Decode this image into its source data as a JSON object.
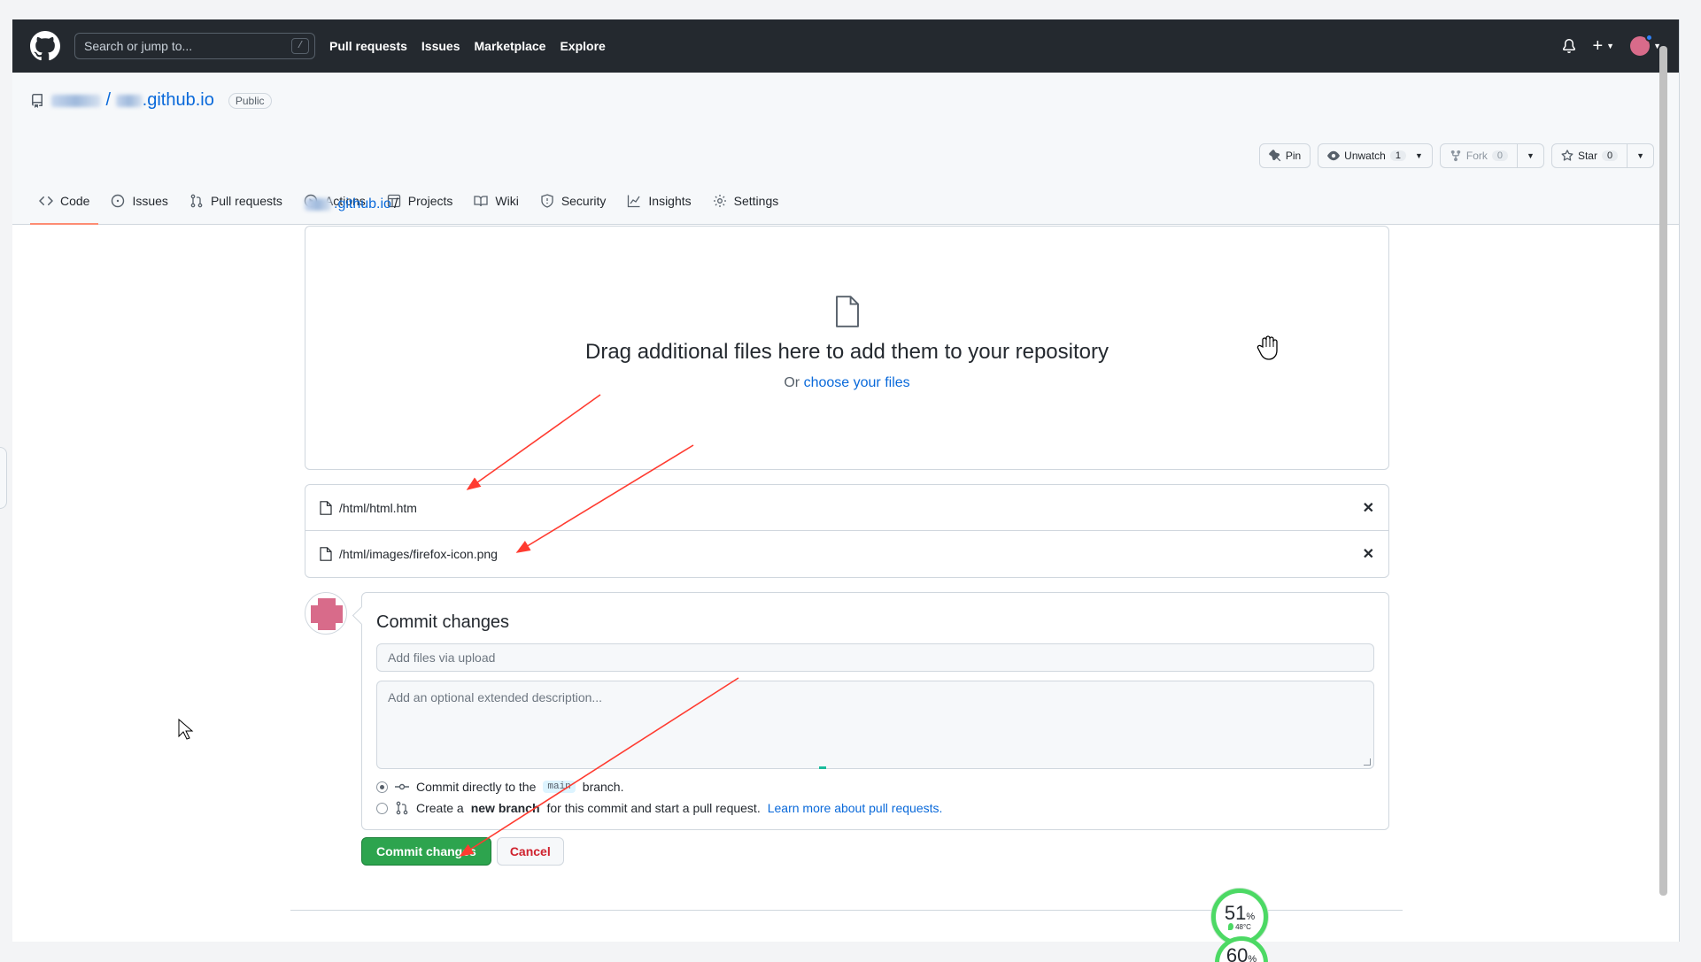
{
  "header": {
    "search_placeholder": "Search or jump to...",
    "search_shortcut": "/",
    "nav": [
      "Pull requests",
      "Issues",
      "Marketplace",
      "Explore"
    ]
  },
  "repo": {
    "name": ".github.io",
    "visibility": "Public",
    "actions": {
      "pin": "Pin",
      "unwatch": "Unwatch",
      "unwatch_count": "1",
      "fork": "Fork",
      "fork_count": "0",
      "star": "Star",
      "star_count": "0"
    },
    "tabs": [
      "Code",
      "Issues",
      "Pull requests",
      "Actions",
      "Projects",
      "Wiki",
      "Security",
      "Insights",
      "Settings"
    ]
  },
  "breadcrumb": {
    "repo": ".github.io",
    "separator": "/"
  },
  "dropzone": {
    "title": "Drag additional files here to add them to your repository",
    "or": "Or",
    "choose": "choose your files"
  },
  "files": [
    {
      "path": "/html/html.htm"
    },
    {
      "path": "/html/images/firefox-icon.png"
    }
  ],
  "commit": {
    "title": "Commit changes",
    "summary_placeholder": "Add files via upload",
    "description_placeholder": "Add an optional extended description...",
    "option_direct_prefix": "Commit directly to the",
    "branch": "main",
    "option_direct_suffix": "branch.",
    "option_new_prefix": "Create a",
    "option_new_bold": "new branch",
    "option_new_suffix": "for this commit and start a pull request.",
    "option_new_link": "Learn more about pull requests.",
    "submit": "Commit changes",
    "cancel": "Cancel"
  },
  "monitor": {
    "cpu": "51",
    "unit": "%",
    "temp": "48°C",
    "second": "60"
  },
  "colors": {
    "header_bg": "#24292f",
    "primary_green": "#2da44e",
    "link_blue": "#0969da",
    "tab_underline": "#fd8c73",
    "annotation_red": "#ff3b30"
  }
}
